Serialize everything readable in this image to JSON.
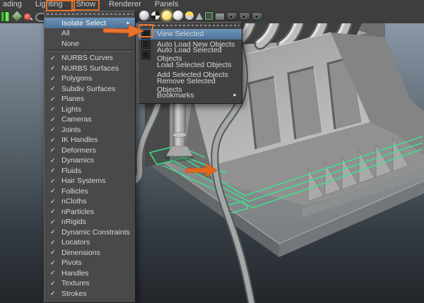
{
  "colors": {
    "accent": "#e8732a",
    "highlight_top": "#6d93b8",
    "highlight_bottom": "#4d7398",
    "selection_green": "#3fe08d",
    "menu_bg": "#494949",
    "header_bg": "#3e3e3e",
    "menu_text": "#d8d8d8"
  },
  "glyphs": {
    "check": "✓",
    "submenu_arrow": "►"
  },
  "menu_bar": {
    "items": [
      {
        "id": "shading-clipped",
        "label": "ading"
      },
      {
        "id": "lighting",
        "label": "Lighting"
      },
      {
        "id": "show",
        "label": "Show",
        "boxed": true
      },
      {
        "id": "renderer",
        "label": "Renderer"
      },
      {
        "id": "panels",
        "label": "Panels"
      }
    ]
  },
  "toolbar": {
    "left_icons": [
      {
        "id": "display-layers",
        "shape": "layers",
        "color": "#53b83e"
      },
      {
        "id": "grid-plane",
        "shape": "diamond",
        "color": "#7fa266"
      },
      {
        "id": "snap-pin",
        "shape": "pin",
        "color": "#cf4136"
      },
      {
        "id": "separator",
        "shape": "sep",
        "color": "#444444"
      },
      {
        "id": "isolate-mask",
        "shape": "mask",
        "color": "#8f8f8f"
      }
    ],
    "right_icons": [
      {
        "id": "shaded-sphere",
        "shape": "sphere",
        "color": "#c9d4de"
      },
      {
        "id": "textured-sphere",
        "shape": "checker",
        "color": "#dddddd"
      },
      {
        "id": "lit-sphere",
        "shape": "glow",
        "color": "#ffe06a"
      },
      {
        "id": "flat-sphere",
        "shape": "sphere",
        "color": "#e0e0e0"
      },
      {
        "id": "material-sphere",
        "shape": "half",
        "color": "#ffd75e"
      },
      {
        "id": "default-light",
        "shape": "cone",
        "color": "#b5b5b5"
      },
      {
        "id": "texture-frame",
        "shape": "frame",
        "color": "#57d06b"
      },
      {
        "id": "xray-chip",
        "shape": "chip",
        "color": "#6f6f6f"
      },
      {
        "id": "film-camera",
        "shape": "cam",
        "color": "#3a3a3a"
      },
      {
        "id": "film-gate",
        "shape": "cam",
        "color": "#454545"
      },
      {
        "id": "resolution-gate",
        "shape": "cam",
        "color": "#2f4a55"
      }
    ]
  },
  "show_menu": {
    "items": [
      {
        "label": "Isolate Select",
        "arrow": true,
        "highlighted": true
      },
      {
        "label": "All"
      },
      {
        "label": "None"
      },
      {
        "type": "separator"
      },
      {
        "label": "NURBS Curves",
        "checked": true
      },
      {
        "label": "NURBS Surfaces",
        "checked": true
      },
      {
        "label": "Polygons",
        "checked": true
      },
      {
        "label": "Subdiv Surfaces",
        "checked": true
      },
      {
        "label": "Planes",
        "checked": true
      },
      {
        "label": "Lights",
        "checked": true
      },
      {
        "label": "Cameras",
        "checked": true
      },
      {
        "label": "Joints",
        "checked": true
      },
      {
        "label": "IK Handles",
        "checked": true
      },
      {
        "label": "Deformers",
        "checked": true
      },
      {
        "label": "Dynamics",
        "checked": true
      },
      {
        "label": "Fluids",
        "checked": true
      },
      {
        "label": "Hair Systems",
        "checked": true
      },
      {
        "label": "Follicles",
        "checked": true
      },
      {
        "label": "nCloths",
        "checked": true
      },
      {
        "label": "nParticles",
        "checked": true
      },
      {
        "label": "nRigids",
        "checked": true
      },
      {
        "label": "Dynamic Constraints",
        "checked": true
      },
      {
        "label": "Locators",
        "checked": true
      },
      {
        "label": "Dimensions",
        "checked": true
      },
      {
        "label": "Pivots",
        "checked": true
      },
      {
        "label": "Handles",
        "checked": true
      },
      {
        "label": "Textures",
        "checked": true
      },
      {
        "label": "Strokes",
        "checked": true
      }
    ]
  },
  "isolate_submenu": {
    "items": [
      {
        "label": "View Selected",
        "checkbox": true,
        "highlighted": true,
        "annotated": true
      },
      {
        "label": "Auto Load New Objects",
        "checkbox": true
      },
      {
        "label": "Auto Load Selected Objects",
        "checkbox": true
      },
      {
        "label": "Load Selected Objects"
      },
      {
        "label": "Add Selected Objects"
      },
      {
        "label": "Remove Selected Objects"
      },
      {
        "label": "Bookmarks",
        "arrow": true
      }
    ]
  }
}
